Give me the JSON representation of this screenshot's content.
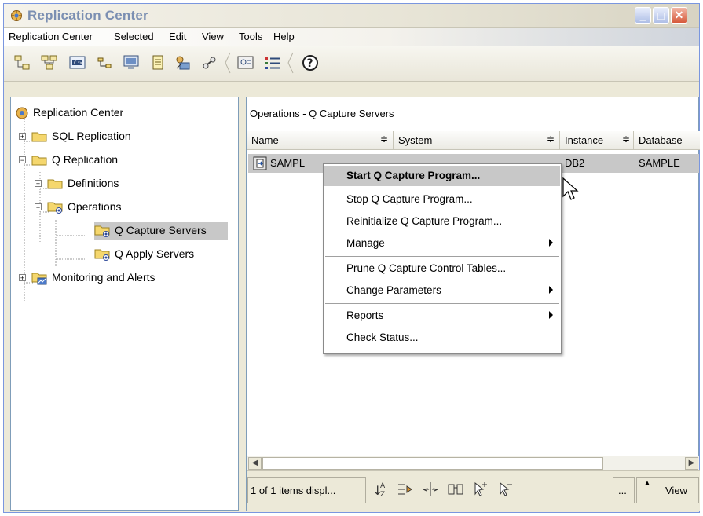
{
  "window": {
    "title": "Replication Center"
  },
  "menubar": {
    "items": [
      "Replication Center",
      "Selected",
      "Edit",
      "View",
      "Tools",
      "Help"
    ]
  },
  "tree": {
    "root": "Replication Center",
    "sql_replication": "SQL Replication",
    "q_replication": "Q Replication",
    "definitions": "Definitions",
    "operations": "Operations",
    "q_capture_servers": "Q Capture Servers",
    "q_apply_servers": "Q Apply Servers",
    "monitoring": "Monitoring and Alerts"
  },
  "content": {
    "title": "Operations - Q Capture Servers",
    "columns": [
      "Name",
      "System",
      "Instance",
      "Database"
    ],
    "sort_glyph": "≑",
    "row": {
      "name": "SAMPL",
      "instance": "DB2",
      "database": "SAMPLE"
    },
    "status_text": "1 of 1 items displ...",
    "ellipsis_button": "...",
    "view_button": "View"
  },
  "context_menu": {
    "items": [
      {
        "label": "Start Q Capture Program...",
        "bold": true,
        "highlighted": true,
        "submenu": false
      },
      {
        "label": "Stop Q Capture Program...",
        "bold": false,
        "highlighted": false,
        "submenu": false
      },
      {
        "label": "Reinitialize Q Capture Program...",
        "bold": false,
        "highlighted": false,
        "submenu": false
      },
      {
        "label": "Manage",
        "bold": false,
        "highlighted": false,
        "submenu": true
      },
      {
        "label": "Prune Q Capture Control Tables...",
        "bold": false,
        "highlighted": false,
        "submenu": false
      },
      {
        "label": "Change Parameters",
        "bold": false,
        "highlighted": false,
        "submenu": true
      },
      {
        "label": "Reports",
        "bold": false,
        "highlighted": false,
        "submenu": true
      },
      {
        "label": "Check Status...",
        "bold": false,
        "highlighted": false,
        "submenu": false
      }
    ]
  },
  "icons": {
    "app": "replication-center-icon",
    "folder": "folder-icon",
    "operations_folder": "operations-folder-icon",
    "help": "help-icon"
  },
  "colors": {
    "selection": "#c8c8c8",
    "title_text": "#7b8fb2",
    "folder": "#f5d76e"
  }
}
